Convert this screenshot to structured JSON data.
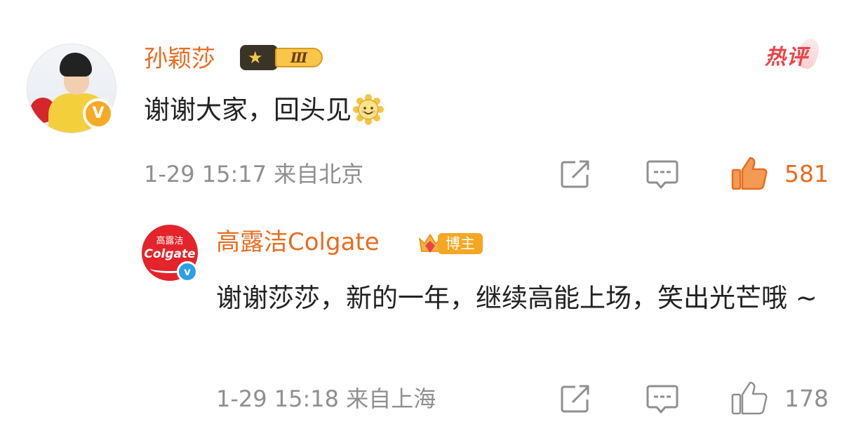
{
  "comment": {
    "author": "孙颖莎",
    "level_badge": "Ⅲ",
    "hot_label": "热评",
    "verified_mark": "V",
    "text": "谢谢大家，回头见",
    "emoji": "sun-smile-emoji",
    "timestamp": "1-29 15:17",
    "location": "来自北京",
    "like_count": "581",
    "liked": true,
    "accent_color": "#e86c20"
  },
  "reply": {
    "author": "高露洁Colgate",
    "role_badge": "博主",
    "avatar_text_top": "高露洁",
    "avatar_text_main": "Colgate",
    "verified_mark": "v",
    "text": "谢谢莎莎，新的一年，继续高能上场，笑出光芒哦 ~",
    "timestamp": "1-29 15:18",
    "location": "来自上海",
    "like_count": "178",
    "liked": false
  }
}
